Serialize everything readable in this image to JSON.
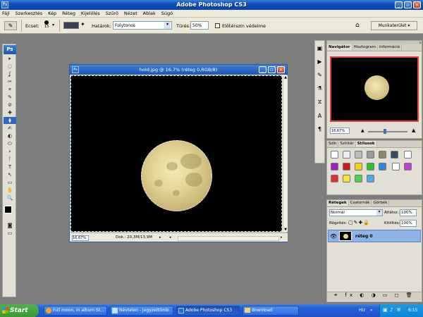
{
  "app": {
    "title": "Adobe Photoshop CS3",
    "logo": "Ps"
  },
  "menu": [
    "Fájl",
    "Szerkesztés",
    "Kép",
    "Réteg",
    "Kijelölés",
    "Szűrő",
    "Nézet",
    "Ablak",
    "Súgó"
  ],
  "options": {
    "brush_label": "Ecset:",
    "brush_size": "13",
    "boundaries_label": "Határok:",
    "boundaries_value": "Folytonos",
    "tolerance_label": "Tűrés:",
    "tolerance_value": "50%",
    "protect_fg_label": "Előtérszín védelme",
    "workspace_label": "Munkaterület ▾"
  },
  "toolbox": {
    "tools": [
      "▸",
      "◌",
      "ʆ",
      "✂",
      "⌗",
      "✎",
      "⊘",
      "✚",
      "⧫",
      "✍",
      "◐",
      "⬭",
      "⌕",
      "ᚪ",
      "T",
      "↖",
      "▭",
      "✋",
      "🔍"
    ]
  },
  "document": {
    "title": "hold.jpg @ 16,7% (réteg 0,RGB/8)",
    "zoom": "16,67%",
    "doc_info": "Dok.: 20,3M/13,9M"
  },
  "navigator": {
    "tabs": [
      "Navigátor",
      "Hisztogram",
      "Információ"
    ],
    "zoom": "16,67%"
  },
  "styles_panel": {
    "tabs": [
      "Szín",
      "Színtár",
      "Stílusok"
    ]
  },
  "layers": {
    "tabs": [
      "Rétegek",
      "Csatornák",
      "Görbék"
    ],
    "blend_mode": "Normál",
    "opacity_label": "Átlátsz.:",
    "opacity_value": "100%",
    "lock_label": "Rögzítés:",
    "fill_label": "Kitöltés:",
    "fill_value": "100%",
    "layer_name": "réteg 0"
  },
  "taskbar": {
    "start_label": "Start",
    "tasks": [
      "Full moon, in album St...",
      "Névtelen - Jegyzettömb",
      "Adobe Photoshop CS3",
      "download"
    ],
    "lang": "HU",
    "time": "6:15"
  },
  "colors": {
    "xp_blue": "#245edb",
    "moon": "#e5d698",
    "selected_layer": "#8fb3e6"
  }
}
